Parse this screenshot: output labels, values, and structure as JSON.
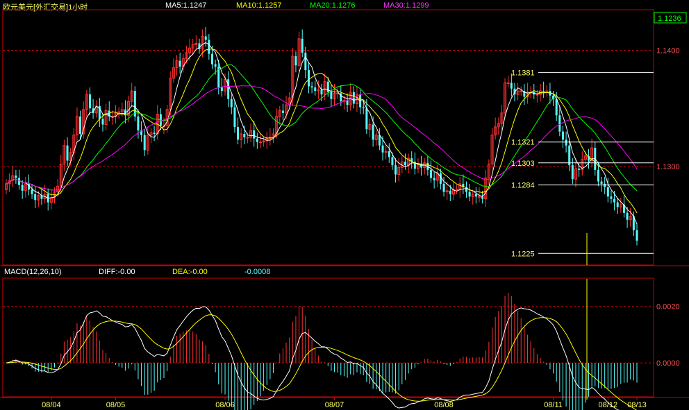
{
  "header": {
    "symbol": "欧元美元[外汇交易]1小时",
    "ma5": "MA5:1.1247",
    "ma10": "MA10:1.1257",
    "ma20": "MA20:1.1276",
    "ma30": "MA30:1.1299"
  },
  "macd_header": {
    "name": "MACD(12,26,10)",
    "diff": "DIFF:-0.00",
    "dea": "DEA:-0.00",
    "macd": "-0.0008"
  },
  "colors": {
    "bg": "#000000",
    "frame": "#cc0000",
    "up": "#ff3232",
    "down": "#54ffff",
    "ma5": "#ffffff",
    "ma10": "#ffff00",
    "ma20": "#00ff00",
    "ma30": "#ff00ff",
    "axis_text": "#ff5050",
    "level": "#ffff66",
    "price_box": "#00ff00"
  },
  "chart_data": [
    {
      "type": "candlestick",
      "title": "欧元美元[外汇交易]1小时",
      "ylim": [
        1.1215,
        1.1435
      ],
      "yticks": [
        "1.1400",
        "1.1300"
      ],
      "x_date_labels": [
        "08/04",
        "08/05",
        "08/06",
        "08/07",
        "08/08",
        "08/11",
        "08/12",
        "08/13"
      ],
      "last_price": "1.1236",
      "levels": [
        "1.1381",
        "1.1321",
        "1.1303",
        "1.1284",
        "1.1225"
      ],
      "close": [
        1.1285,
        1.1288,
        1.1292,
        1.129,
        1.1284,
        1.1279,
        1.1285,
        1.128,
        1.1276,
        1.1271,
        1.1275,
        1.1272,
        1.1276,
        1.1269,
        1.1273,
        1.1278,
        1.1283,
        1.1302,
        1.1318,
        1.1305,
        1.1312,
        1.1327,
        1.1343,
        1.1328,
        1.1349,
        1.1362,
        1.135,
        1.1346,
        1.1352,
        1.1341,
        1.1336,
        1.1348,
        1.1343,
        1.1343,
        1.1346,
        1.1347,
        1.1349,
        1.1344,
        1.1356,
        1.1365,
        1.1343,
        1.1331,
        1.1327,
        1.1314,
        1.1327,
        1.1329,
        1.1328,
        1.1345,
        1.1335,
        1.1335,
        1.1349,
        1.1376,
        1.1385,
        1.1391,
        1.1386,
        1.1393,
        1.1398,
        1.1402,
        1.1405,
        1.1406,
        1.1401,
        1.1412,
        1.1409,
        1.1397,
        1.1388,
        1.1386,
        1.1368,
        1.1365,
        1.1375,
        1.1358,
        1.1351,
        1.1334,
        1.1323,
        1.1328,
        1.1325,
        1.1325,
        1.1331,
        1.1324,
        1.1321,
        1.1321,
        1.1322,
        1.1324,
        1.1325,
        1.1328,
        1.1343,
        1.1348,
        1.1346,
        1.1353,
        1.1359,
        1.1395,
        1.1387,
        1.141,
        1.1398,
        1.1383,
        1.1369,
        1.1368,
        1.1365,
        1.1366,
        1.1362,
        1.1373,
        1.1364,
        1.1358,
        1.1363,
        1.1363,
        1.1356,
        1.1357,
        1.1353,
        1.1364,
        1.1354,
        1.1362,
        1.1351,
        1.135,
        1.1332,
        1.1336,
        1.1323,
        1.1327,
        1.1318,
        1.1312,
        1.1313,
        1.1308,
        1.1301,
        1.1293,
        1.1299,
        1.1304,
        1.1301,
        1.1307,
        1.1304,
        1.1298,
        1.1302,
        1.1299,
        1.1303,
        1.1297,
        1.129,
        1.1288,
        1.1294,
        1.1285,
        1.1278,
        1.1279,
        1.1276,
        1.128,
        1.128,
        1.1285,
        1.1282,
        1.1278,
        1.1274,
        1.1276,
        1.1274,
        1.1274,
        1.1272,
        1.129,
        1.1302,
        1.1327,
        1.1334,
        1.1337,
        1.1346,
        1.1372,
        1.1372,
        1.1367,
        1.1362,
        1.1365,
        1.1365,
        1.136,
        1.1364,
        1.1364,
        1.1362,
        1.1362,
        1.1365,
        1.1364,
        1.1365,
        1.1361,
        1.1358,
        1.1344,
        1.133,
        1.1323,
        1.1318,
        1.1301,
        1.1289,
        1.1298,
        1.1297,
        1.1306,
        1.1309,
        1.1305,
        1.1316,
        1.1297,
        1.1287,
        1.1285,
        1.1282,
        1.1274,
        1.1272,
        1.1269,
        1.1265,
        1.1267,
        1.126,
        1.1254,
        1.1257,
        1.1245,
        1.1236
      ],
      "ma_labels": [
        "MA5:1.1247",
        "MA10:1.1257",
        "MA20:1.1276",
        "MA30:1.1299"
      ]
    },
    {
      "type": "macd",
      "title": "MACD(12,26,10)",
      "ylim": [
        -0.0012,
        0.003
      ],
      "yticks": [
        "0.0020",
        "0.0000"
      ],
      "diff_label": "DIFF:-0.00",
      "dea_label": "DEA:-0.00",
      "macd_value": "-0.0008"
    }
  ]
}
